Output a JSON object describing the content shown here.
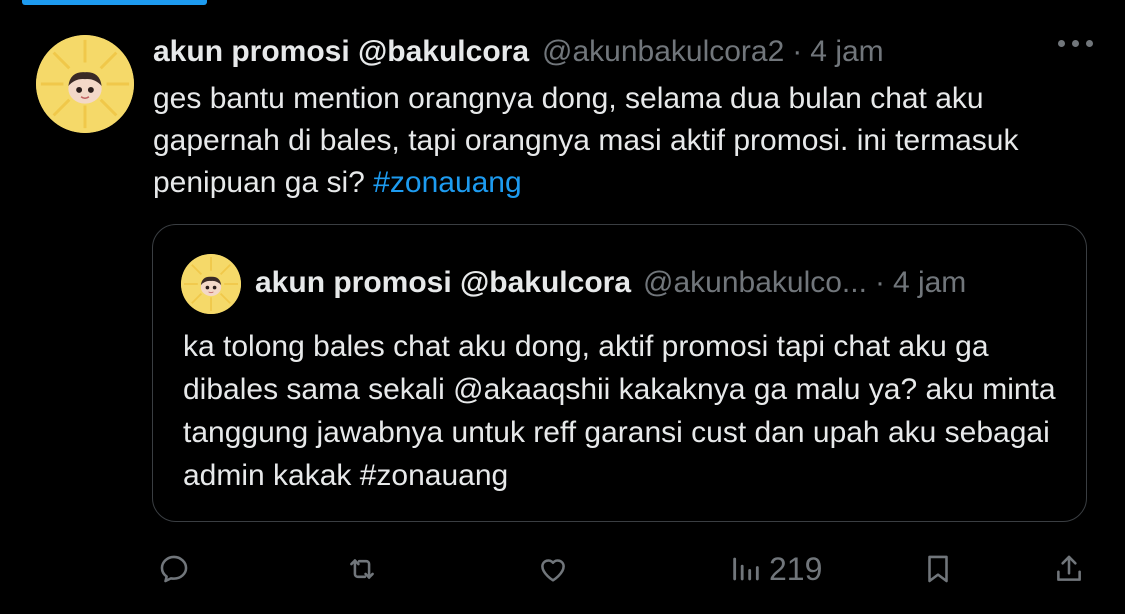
{
  "tweet": {
    "author_name": "akun promosi @bakulcora",
    "author_handle": "@akunbakulcora2",
    "separator": "·",
    "time": "4 jam",
    "text": "ges bantu mention orangnya dong, selama dua bulan chat aku gapernah di bales, tapi orangnya masi aktif promosi. ini termasuk penipuan ga si?",
    "hashtag": "#zonauang"
  },
  "quote": {
    "author_name": "akun promosi @bakulcora",
    "author_handle": "@akunbakulco...",
    "separator": "·",
    "time": "4 jam",
    "text": "ka tolong bales chat aku dong, aktif promosi tapi chat aku ga dibales sama sekali @akaaqshii kakaknya ga malu ya? aku minta tanggung jawabnya untuk reff garansi cust dan upah aku sebagai admin kakak #zonauang"
  },
  "actions": {
    "views": "219",
    "icons": [
      "reply-icon",
      "retweet-icon",
      "like-icon",
      "views-icon",
      "bookmark-icon",
      "share-icon"
    ]
  },
  "colors": {
    "background": "#000000",
    "text": "#e7e9ea",
    "muted": "#71767b",
    "link": "#1d9bf0",
    "border": "#3a3e42"
  }
}
